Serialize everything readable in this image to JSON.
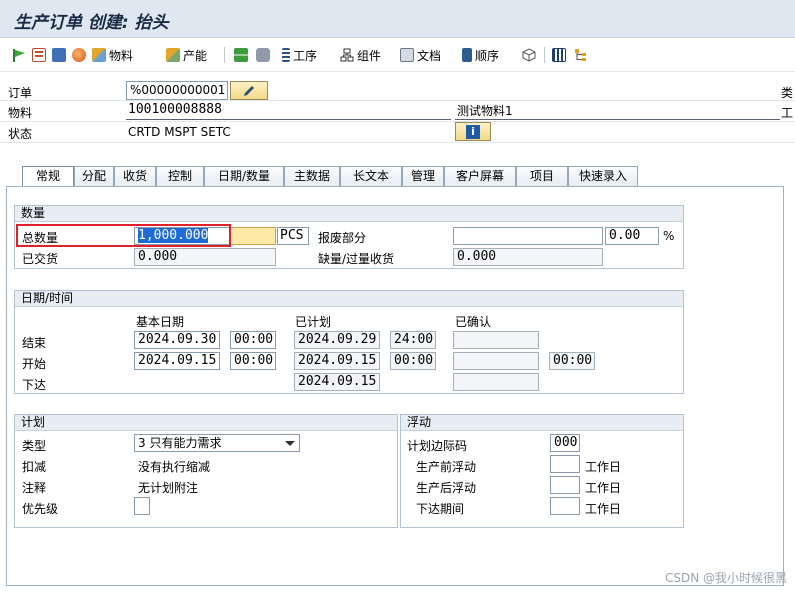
{
  "title": "生产订单 创建: 抬头",
  "toolbar": {
    "material": "物料",
    "capacity": "产能",
    "operations": "工序",
    "components": "组件",
    "documents": "文档",
    "sequences": "顺序"
  },
  "header": {
    "order_label": "订单",
    "order_value": "%00000000001",
    "type_label_trunc": "类",
    "material_label": "物料",
    "material_value": "100100008888",
    "material_desc": "测试物料1",
    "plant_label_trunc": "工",
    "status_label": "状态",
    "status_value": "CRTD MSPT SETC"
  },
  "tabs": [
    "常规",
    "分配",
    "收货",
    "控制",
    "日期/数量",
    "主数据",
    "长文本",
    "管理",
    "客户屏幕",
    "项目",
    "快速录入"
  ],
  "quantity": {
    "title": "数量",
    "total_label": "总数量",
    "total_value": "1,000.000",
    "unit": "PCS",
    "scrap_label": "报废部分",
    "scrap_value": "",
    "scrap_pct": "0.00",
    "pct": "%",
    "delivered_label": "已交货",
    "delivered_value": "0.000",
    "short_label": "缺量/过量收货",
    "short_value": "0.000"
  },
  "dates": {
    "title": "日期/时间",
    "basic_col": "基本日期",
    "scheduled_col": "已计划",
    "confirmed_col": "已确认",
    "end_label": "结束",
    "start_label": "开始",
    "release_label": "下达",
    "end_basic_date": "2024.09.30",
    "end_basic_time": "00:00",
    "end_sched_date": "2024.09.29",
    "end_sched_time": "24:00",
    "start_basic_date": "2024.09.15",
    "start_basic_time": "00:00",
    "start_sched_date": "2024.09.15",
    "start_sched_time": "00:00",
    "start_conf_time": "00:00",
    "release_sched_date": "2024.09.15"
  },
  "plan": {
    "title": "计划",
    "type_label": "类型",
    "type_value": "3 只有能力需求",
    "reduction_label": "扣减",
    "reduction_value": "没有执行缩减",
    "note_label": "注释",
    "note_value": "无计划附注",
    "priority_label": "优先级"
  },
  "float": {
    "title": "浮动",
    "margin_label": "计划边际码",
    "margin_value": "000",
    "before_label": "生产前浮动",
    "after_label": "生产后浮动",
    "release_label": "下达期间",
    "unit": "工作日"
  },
  "watermark": "CSDN @我小时候很黑"
}
